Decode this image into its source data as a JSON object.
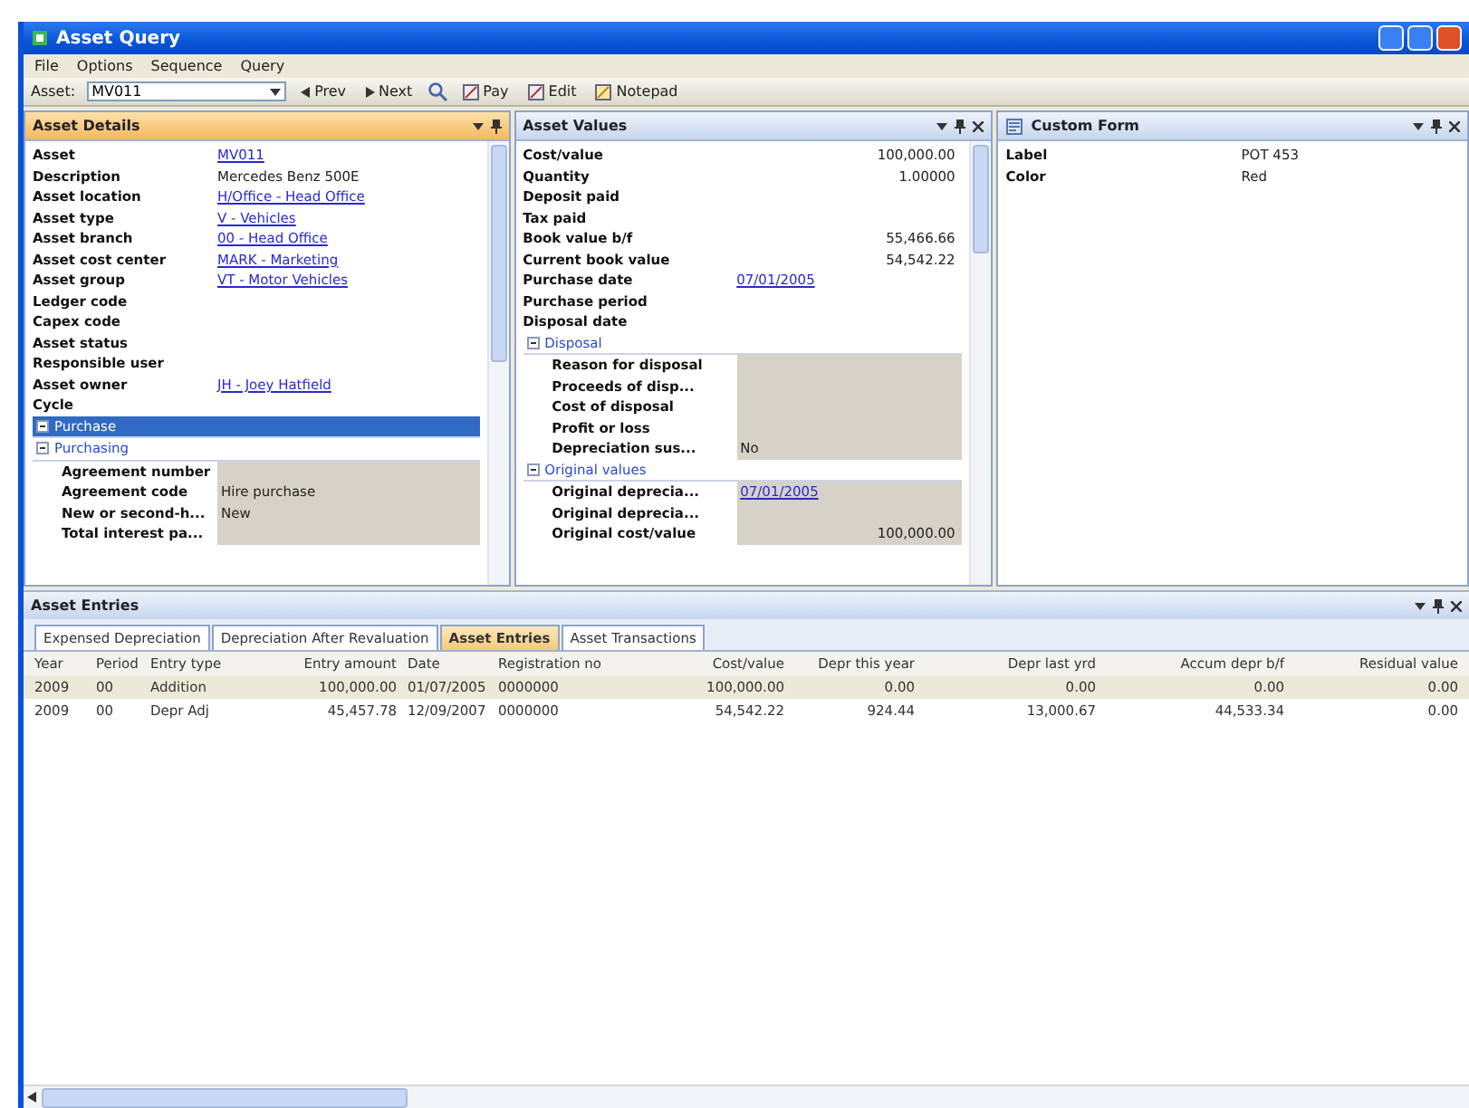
{
  "window": {
    "title": "Asset Query"
  },
  "menu": [
    "File",
    "Options",
    "Sequence",
    "Query"
  ],
  "toolbar": {
    "asset_label": "Asset:",
    "asset_value": "MV011",
    "prev": "Prev",
    "next": "Next",
    "buttons": [
      "Pay",
      "Edit",
      "Notepad"
    ]
  },
  "panels": [
    {
      "title": "Asset Details",
      "active": true,
      "closable": false,
      "scrollbar": true,
      "rows": [
        {
          "kind": "field",
          "label": "Asset",
          "value": "MV011",
          "link": true
        },
        {
          "kind": "field",
          "label": "Description",
          "value": "Mercedes Benz 500E"
        },
        {
          "kind": "field",
          "label": "Asset location",
          "value": "H/Office  - Head Office",
          "link": true
        },
        {
          "kind": "field",
          "label": "Asset type",
          "value": "V - Vehicles",
          "link": true
        },
        {
          "kind": "field",
          "label": "Asset branch",
          "value": "00 - Head Office",
          "link": true
        },
        {
          "kind": "field",
          "label": "Asset cost center",
          "value": "MARK  - Marketing",
          "link": true
        },
        {
          "kind": "field",
          "label": "Asset group",
          "value": "VT  - Motor Vehicles",
          "link": true
        },
        {
          "kind": "field",
          "label": "Ledger code"
        },
        {
          "kind": "field",
          "label": "Capex code"
        },
        {
          "kind": "field",
          "label": "Asset status"
        },
        {
          "kind": "field",
          "label": "Responsible user"
        },
        {
          "kind": "field",
          "label": "Asset owner",
          "value": "JH  - Joey Hatfield",
          "link": true
        },
        {
          "kind": "field",
          "label": "Cycle"
        },
        {
          "kind": "group",
          "label": "Purchase",
          "expanded": true,
          "selected": true,
          "children": []
        },
        {
          "kind": "group",
          "label": "Purchasing",
          "expanded": true,
          "selected": false,
          "children": [
            {
              "kind": "field",
              "label": "Agreement number"
            },
            {
              "kind": "field",
              "label": "Agreement code",
              "value": "Hire purchase"
            },
            {
              "kind": "field",
              "label": "New or second-h...",
              "value": "New"
            },
            {
              "kind": "field",
              "label": "Total interest pa..."
            }
          ]
        }
      ]
    },
    {
      "title": "Asset Values",
      "active": false,
      "closable": true,
      "scrollbar": true,
      "rows": [
        {
          "kind": "amount",
          "label": "Cost/value",
          "value": "100,000.00"
        },
        {
          "kind": "amount",
          "label": "Quantity",
          "value": "1.00000"
        },
        {
          "kind": "field",
          "label": "Deposit paid"
        },
        {
          "kind": "field",
          "label": "Tax paid"
        },
        {
          "kind": "amount",
          "label": "Book value b/f",
          "value": "55,466.66"
        },
        {
          "kind": "amount",
          "label": "Current book value",
          "value": "54,542.22"
        },
        {
          "kind": "field",
          "label": "Purchase date",
          "value": "07/01/2005",
          "link": true
        },
        {
          "kind": "field",
          "label": "Purchase period"
        },
        {
          "kind": "field",
          "label": "Disposal date"
        },
        {
          "kind": "group",
          "label": "Disposal",
          "expanded": true,
          "selected": false,
          "children": [
            {
              "kind": "field",
              "label": "Reason for disposal"
            },
            {
              "kind": "field",
              "label": "Proceeds of disp..."
            },
            {
              "kind": "field",
              "label": "Cost of disposal"
            },
            {
              "kind": "field",
              "label": "Profit or loss"
            },
            {
              "kind": "field",
              "label": "Depreciation sus...",
              "value": "No"
            }
          ]
        },
        {
          "kind": "group",
          "label": "Original values",
          "expanded": true,
          "selected": false,
          "children": [
            {
              "kind": "field",
              "label": "Original deprecia...",
              "value": "07/01/2005",
              "link": true
            },
            {
              "kind": "field",
              "label": "Original deprecia..."
            },
            {
              "kind": "amount",
              "label": "Original cost/value",
              "value": "100,000.00"
            }
          ]
        }
      ]
    },
    {
      "title": "Custom Form",
      "active": false,
      "closable": true,
      "scrollbar": false,
      "rows": [
        {
          "kind": "field",
          "label": "Label",
          "value": "POT 453"
        },
        {
          "kind": "field",
          "label": "Color",
          "value": "Red"
        }
      ]
    }
  ],
  "entries": {
    "title": "Asset Entries",
    "tabs": [
      {
        "label": "Expensed Depreciation",
        "selected": false
      },
      {
        "label": "Depreciation After Revaluation",
        "selected": false
      },
      {
        "label": "Asset Entries",
        "selected": true
      },
      {
        "label": "Asset Transactions",
        "selected": false
      }
    ],
    "columns": [
      "Year",
      "Period",
      "Entry type",
      "Entry amount",
      "Date",
      "Registration no",
      "Cost/value",
      "Depr this year",
      "Depr last yrd",
      "Accum depr b/f",
      "Residual value"
    ],
    "rows": [
      {
        "selected": true,
        "cells": [
          "2009",
          "00",
          "Addition",
          "100,000.00",
          "01/07/2005",
          "0000000",
          "100,000.00",
          "0.00",
          "0.00",
          "0.00",
          "0.00"
        ]
      },
      {
        "selected": false,
        "cells": [
          "2009",
          "00",
          "Depr Adj",
          "45,457.78",
          "12/09/2007",
          "0000000",
          "54,542.22",
          "924.44",
          "13,000.67",
          "44,533.34",
          "0.00"
        ]
      }
    ]
  }
}
